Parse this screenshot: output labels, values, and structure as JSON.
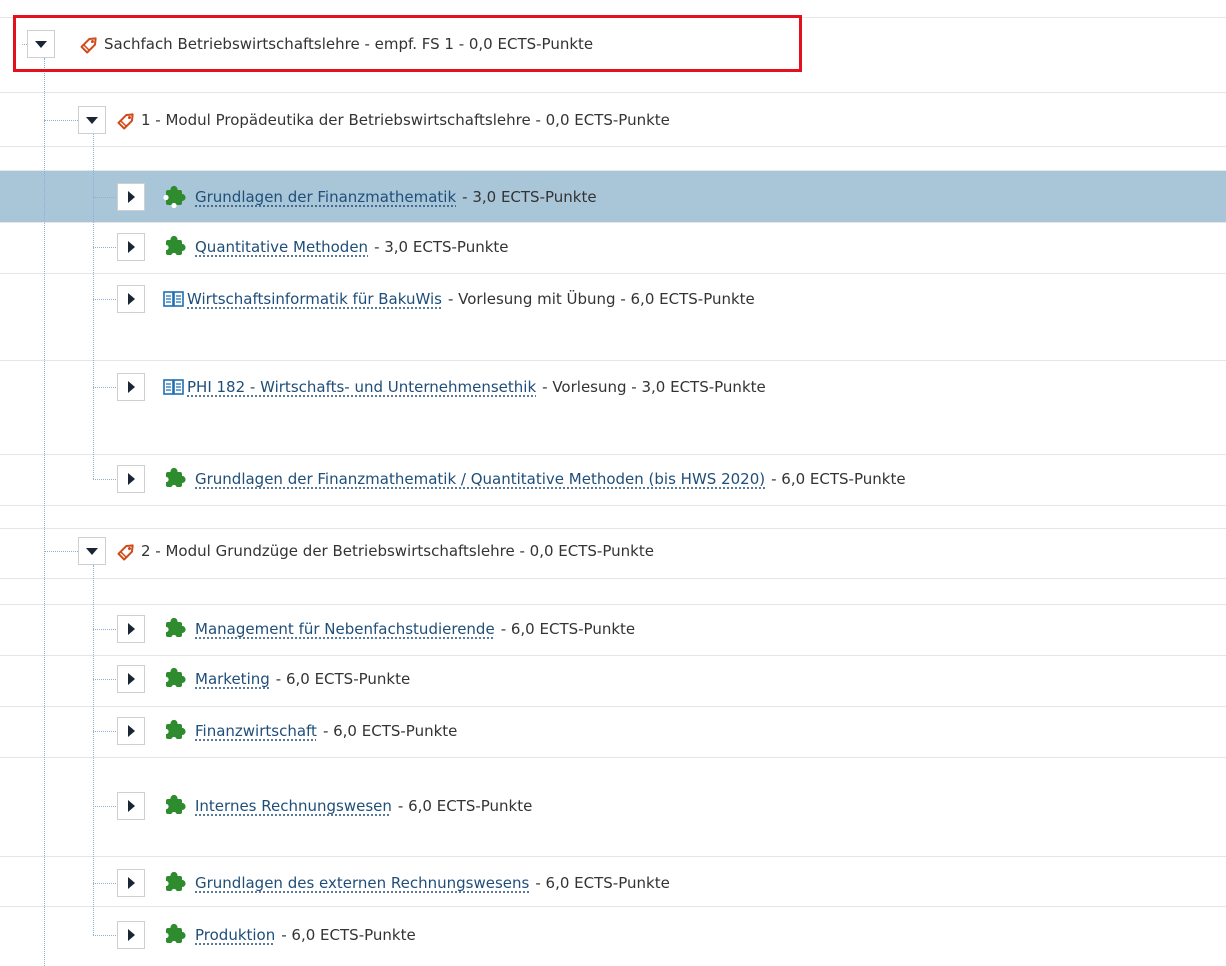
{
  "root": {
    "label": "Sachfach Betriebswirtschaftslehre - empf. FS 1 - 0,0 ECTS-Punkte",
    "icon": "tag-icon",
    "expanded": true,
    "highlight_color": "#e3101d"
  },
  "modules": [
    {
      "label": "1 - Modul Propädeutika der Betriebswirtschaftslehre - 0,0 ECTS-Punkte",
      "icon": "tag-icon",
      "expanded": true,
      "items": [
        {
          "title": "Grundlagen der Finanzmathematik",
          "suffix": "- 3,0 ECTS-Punkte",
          "icon": "puzzle-icon",
          "selected": true
        },
        {
          "title": "Quantitative Methoden",
          "suffix": "- 3,0 ECTS-Punkte",
          "icon": "puzzle-icon"
        },
        {
          "title": "Wirtschaftsinformatik für BakuWis",
          "suffix": "- Vorlesung mit Übung - 6,0 ECTS-Punkte",
          "icon": "book-icon"
        },
        {
          "title": "PHI 182 - Wirtschafts- und Unternehmensethik",
          "suffix": "- Vorlesung - 3,0 ECTS-Punkte",
          "icon": "book-icon"
        },
        {
          "title": "Grundlagen der Finanzmathematik / Quantitative Methoden (bis HWS 2020)",
          "suffix": "- 6,0 ECTS-Punkte",
          "icon": "puzzle-icon"
        }
      ]
    },
    {
      "label": "2 - Modul Grundzüge der Betriebswirtschaftslehre - 0,0 ECTS-Punkte",
      "icon": "tag-icon",
      "expanded": true,
      "items": [
        {
          "title": "Management für Nebenfachstudierende",
          "suffix": "- 6,0 ECTS-Punkte",
          "icon": "puzzle-icon"
        },
        {
          "title": "Marketing",
          "suffix": "- 6,0 ECTS-Punkte",
          "icon": "puzzle-icon"
        },
        {
          "title": "Finanzwirtschaft",
          "suffix": "- 6,0 ECTS-Punkte",
          "icon": "puzzle-icon"
        },
        {
          "title": "Internes Rechnungswesen",
          "suffix": "- 6,0 ECTS-Punkte",
          "icon": "puzzle-icon"
        },
        {
          "title": "Grundlagen des externen Rechnungswesens",
          "suffix": "- 6,0 ECTS-Punkte",
          "icon": "puzzle-icon"
        },
        {
          "title": "Produktion",
          "suffix": "- 6,0 ECTS-Punkte",
          "icon": "puzzle-icon"
        }
      ]
    }
  ],
  "colors": {
    "link": "#1f4e79",
    "selected_row": "#a9c6d8",
    "puzzle": "#2e8b2e",
    "book": "#1f6fb5",
    "tag": "#d04a1a"
  }
}
